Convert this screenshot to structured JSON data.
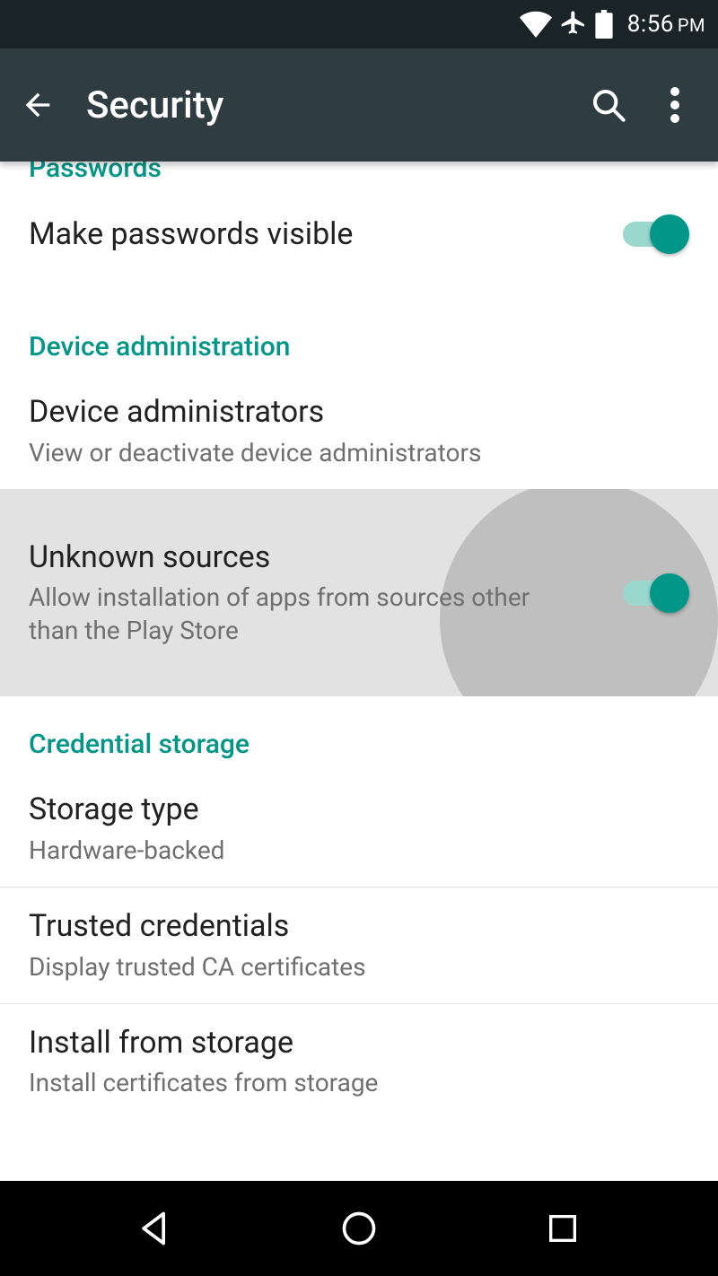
{
  "status": {
    "time": "8:56",
    "ampm": "PM"
  },
  "appbar": {
    "title": "Security"
  },
  "sections": {
    "passwords": {
      "header": "Passwords",
      "makeVisible": {
        "title": "Make passwords visible",
        "on": true
      }
    },
    "deviceAdmin": {
      "header": "Device administration",
      "admins": {
        "title": "Device administrators",
        "subtitle": "View or deactivate device administrators"
      },
      "unknown": {
        "title": "Unknown sources",
        "subtitle": "Allow installation of apps from sources other than the Play Store",
        "on": true
      }
    },
    "credStorage": {
      "header": "Credential storage",
      "storageType": {
        "title": "Storage type",
        "subtitle": "Hardware-backed"
      },
      "trusted": {
        "title": "Trusted credentials",
        "subtitle": "Display trusted CA certificates"
      },
      "install": {
        "title": "Install from storage",
        "subtitle": "Install certificates from storage"
      }
    }
  }
}
